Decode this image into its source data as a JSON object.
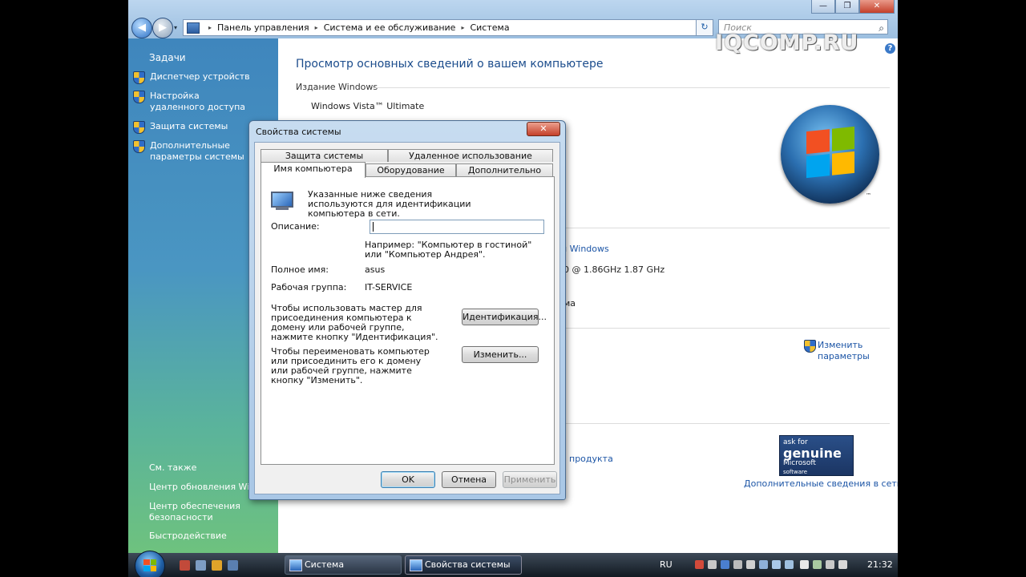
{
  "window": {
    "minimize": "—",
    "maximize": "❐",
    "close": "✕"
  },
  "nav": {
    "back": "◀",
    "forward": "▶",
    "dropdown": "▾"
  },
  "address": {
    "crumbs": [
      "Панель управления",
      "Система и ее обслуживание",
      "Система"
    ],
    "sep": "▸",
    "dropdown": "▾",
    "refresh": "↻"
  },
  "search": {
    "placeholder": "Поиск",
    "icon": "⌕"
  },
  "watermark": "IQCOMP.RU",
  "left": {
    "tasks_header": "Задачи",
    "tasks": [
      "Диспетчер устройств",
      "Настройка удаленного доступа",
      "Защита системы",
      "Дополнительные параметры системы"
    ],
    "see_also_header": "См. также",
    "see_also": [
      "Центр обновления Windows",
      "Центр обеспечения безопасности",
      "Быстродействие"
    ]
  },
  "main": {
    "title": "Просмотр основных сведений о вашем компьютере",
    "help": "?",
    "edition_label": "Издание Windows",
    "edition": "Windows Vista™ Ultimate",
    "tm": "™",
    "windows_link_fragment": "и Windows",
    "cpu_fragment": "0  @ 1.86GHz   1.87 GHz",
    "ma_fragment": "ма",
    "change_link": "Изменить параметры",
    "product_fragment": "ч продукта",
    "genuine_more": "Дополнительные сведения в сети...",
    "genuine": {
      "l1": "ask for",
      "l2": "genuine",
      "l3": "Microsoft",
      "l4": "software"
    }
  },
  "dialog": {
    "title": "Свойства системы",
    "close": "✕",
    "tabs_top": [
      "Защита системы",
      "Удаленное использование"
    ],
    "tabs_bottom": [
      "Имя компьютера",
      "Оборудование",
      "Дополнительно"
    ],
    "intro": "Указанные ниже сведения используются для идентификации компьютера в сети.",
    "description_label": "Описание:",
    "description_value": "",
    "example": "Например: \"Компьютер в гостиной\" или \"Компьютер Андрея\".",
    "fullname_label": "Полное имя:",
    "fullname_value": "asus",
    "workgroup_label": "Рабочая группа:",
    "workgroup_value": "IT-SERVICE",
    "wizard_text": "Чтобы использовать мастер для присоединения компьютера к домену или рабочей группе, нажмите кнопку \"Идентификация\".",
    "identify_button": "Идентификация...",
    "rename_text": "Чтобы переименовать компьютер или присоединить его к домену или рабочей группе, нажмите кнопку \"Изменить\".",
    "change_button": "Изменить...",
    "ok": "OK",
    "cancel": "Отмена",
    "apply": "Применить"
  },
  "taskbar": {
    "items": [
      "Система",
      "Свойства системы"
    ],
    "lang": "RU",
    "time": "21:32"
  },
  "colors": {
    "link": "#1c55a6",
    "title": "#1b4c8c"
  }
}
